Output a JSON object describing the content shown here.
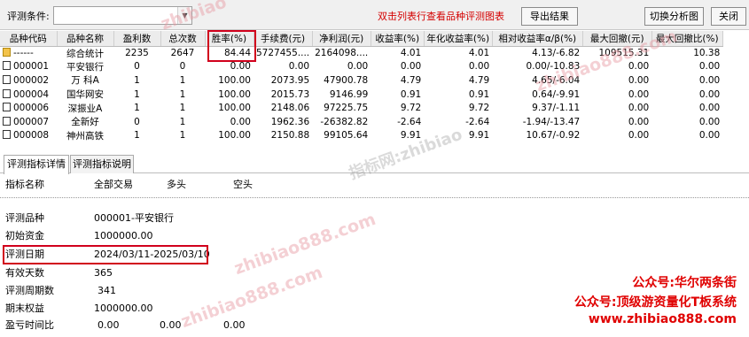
{
  "toolbar": {
    "label": "评测条件:",
    "combo_value": "",
    "hint": "双击列表行查看品种评测图表",
    "export_button": "导出结果",
    "switch_button": "切换分析图",
    "close_button": "关闭"
  },
  "table": {
    "columns": [
      "品种代码",
      "品种名称",
      "盈利数",
      "总次数",
      "胜率(%)",
      "手续费(元)",
      "净利润(元)",
      "收益率(%)",
      "年化收益率(%)",
      "相对收益率α/β(%)",
      "最大回撤(元)",
      "最大回撤比(%)"
    ],
    "rows": [
      [
        "------",
        "综合统计",
        "2235",
        "2647",
        "84.44",
        "5727455....",
        "2164098....",
        "4.01",
        "4.01",
        "4.13/-6.82",
        "109515.31",
        "10.38"
      ],
      [
        "000001",
        "平安银行",
        "0",
        "0",
        "0.00",
        "0.00",
        "0.00",
        "0.00",
        "0.00",
        "0.00/-10.83",
        "0.00",
        "0.00"
      ],
      [
        "000002",
        "万 科A",
        "1",
        "1",
        "100.00",
        "2073.95",
        "47900.78",
        "4.79",
        "4.79",
        "4.65/-6.04",
        "0.00",
        "0.00"
      ],
      [
        "000004",
        "国华网安",
        "1",
        "1",
        "100.00",
        "2015.73",
        "9146.99",
        "0.91",
        "0.91",
        "0.64/-9.91",
        "0.00",
        "0.00"
      ],
      [
        "000006",
        "深振业A",
        "1",
        "1",
        "100.00",
        "2148.06",
        "97225.75",
        "9.72",
        "9.72",
        "9.37/-1.11",
        "0.00",
        "0.00"
      ],
      [
        "000007",
        "全新好",
        "0",
        "1",
        "0.00",
        "1962.36",
        "-26382.82",
        "-2.64",
        "-2.64",
        "-1.94/-13.47",
        "0.00",
        "0.00"
      ],
      [
        "000008",
        "神州高铁",
        "1",
        "1",
        "100.00",
        "2150.88",
        "99105.64",
        "9.91",
        "9.91",
        "10.67/-0.92",
        "0.00",
        "0.00"
      ]
    ]
  },
  "tabs": [
    "评测指标详情",
    "评测指标说明"
  ],
  "detail": {
    "header": [
      "指标名称",
      "全部交易",
      "多头",
      "空头"
    ],
    "rows": [
      {
        "label": "评测品种",
        "value": "000001-平安银行"
      },
      {
        "label": "初始资金",
        "value": "1000000.00"
      },
      {
        "label": "评测日期",
        "value": "2024/03/11-2025/03/10"
      },
      {
        "label": "有效天数",
        "value": "365"
      },
      {
        "label": "评测周期数",
        "value": "341"
      },
      {
        "label": "期末权益",
        "value": "1000000.00"
      },
      {
        "label": "盈亏时间比",
        "value": "0.00",
        "long": "0.00",
        "short": "0.00"
      }
    ]
  },
  "watermarks": {
    "top1": "zhibiao",
    "top2": "zhibiao888.com",
    "mid": "指标网:zhibiao",
    "d1": "zhibiao888.com",
    "d2": "zhibiao888.com"
  },
  "promo": {
    "line1": "公众号:华尔两条街",
    "line2": "公众号:顶级游资量化T板系统",
    "line3": "www.zhibiao888.com"
  }
}
